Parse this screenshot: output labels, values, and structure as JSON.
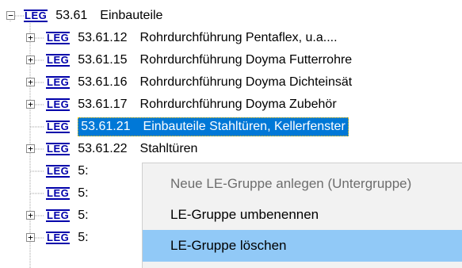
{
  "tree": {
    "root": {
      "badge": "LEG",
      "code": "53.61",
      "title": "Einbauteile"
    },
    "children": [
      {
        "badge": "LEG",
        "code": "53.61.12",
        "title": "Rohrdurchführung Pentaflex, u.a....",
        "expandable": true
      },
      {
        "badge": "LEG",
        "code": "53.61.15",
        "title": "Rohrdurchführung Doyma Futterrohre",
        "expandable": true
      },
      {
        "badge": "LEG",
        "code": "53.61.16",
        "title": "Rohrdurchführung Doyma Dichteinsät",
        "expandable": true
      },
      {
        "badge": "LEG",
        "code": "53.61.17",
        "title": "Rohrdurchführung Doyma Zubehör",
        "expandable": true
      },
      {
        "badge": "LEG",
        "code": "53.61.21",
        "title": "Einbauteile Stahltüren, Kellerfenster",
        "expandable": false,
        "selected": true
      },
      {
        "badge": "LEG",
        "code": "53.61.22",
        "title": "Stahltüren",
        "expandable": true
      },
      {
        "badge": "LEG",
        "code": "5:",
        "title": "",
        "expandable": false
      },
      {
        "badge": "LEG",
        "code": "5:",
        "title": "",
        "expandable": false
      },
      {
        "badge": "LEG",
        "code": "5:",
        "title": "",
        "expandable": true
      },
      {
        "badge": "LEG",
        "code": "5:",
        "title": "",
        "expandable": true
      }
    ],
    "expand_symbol": "+",
    "collapse_symbol": "−"
  },
  "context_menu": {
    "items": [
      {
        "label": "Neue LE-Gruppe anlegen (Untergruppe)",
        "disabled": true
      },
      {
        "label": "LE-Gruppe umbenennen",
        "disabled": false
      },
      {
        "label": "LE-Gruppe löschen",
        "disabled": false,
        "hover": true
      }
    ]
  },
  "colors": {
    "selection": "#0078d7",
    "menu_hover": "#91c9f7",
    "badge": "#0000aa"
  }
}
